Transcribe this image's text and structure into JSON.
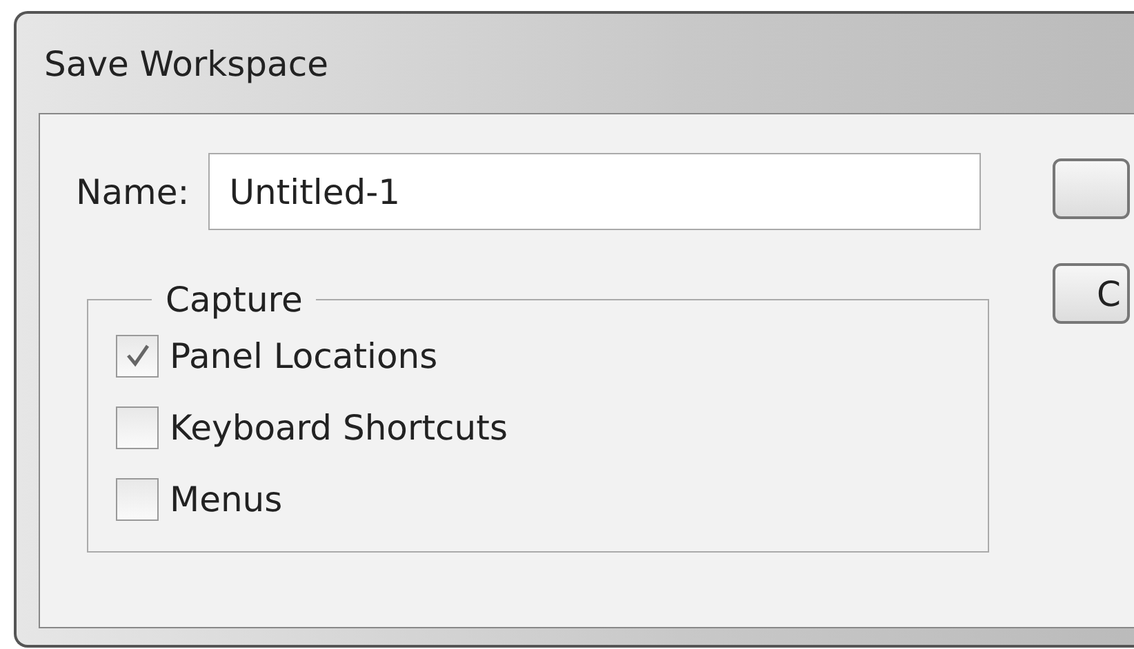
{
  "window": {
    "title": "Save Workspace"
  },
  "name_field": {
    "label": "Name:",
    "value": "Untitled-1"
  },
  "capture": {
    "legend": "Capture",
    "options": [
      {
        "label": "Panel Locations",
        "checked": true
      },
      {
        "label": "Keyboard Shortcuts",
        "checked": false
      },
      {
        "label": "Menus",
        "checked": false
      }
    ]
  },
  "buttons": [
    {
      "label": "C"
    }
  ]
}
